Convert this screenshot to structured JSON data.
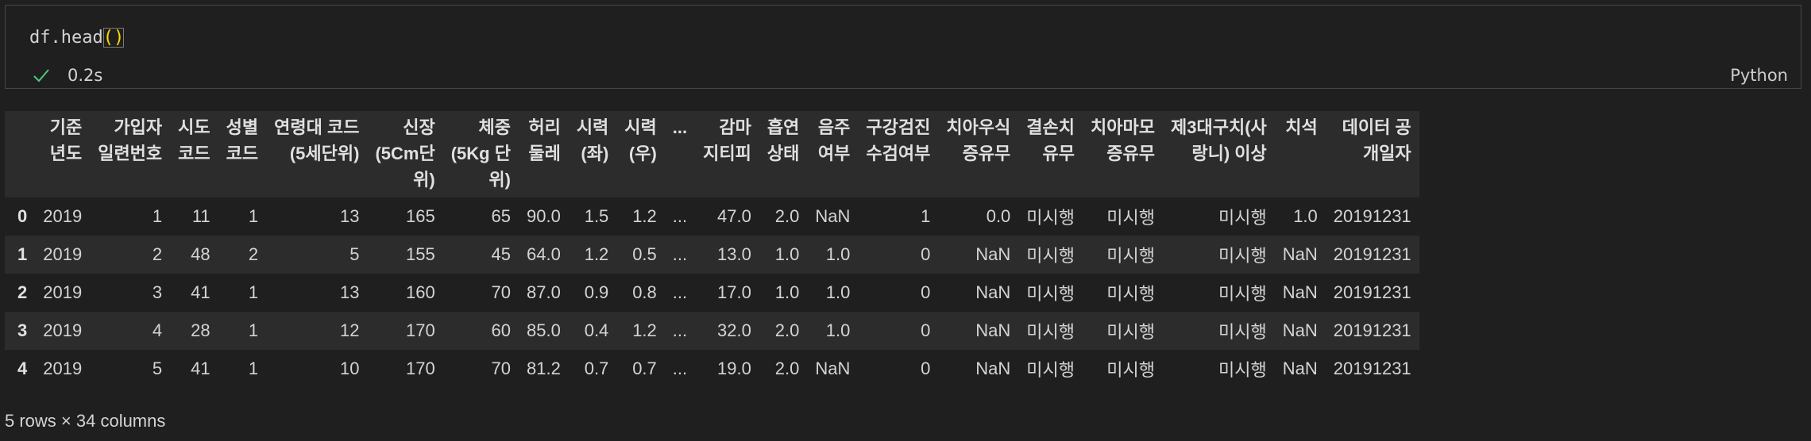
{
  "cell": {
    "code_prefix": "df.head",
    "code_parens": "()",
    "status_time": "0.2s",
    "language": "Python"
  },
  "table": {
    "columns": [
      "",
      "기준\n년도",
      "가입자\n일련번호",
      "시도\n코드",
      "성별\n코드",
      "연령대 코드\n(5세단위)",
      "신장\n(5Cm단\n위)",
      "체중\n(5Kg 단\n위)",
      "허리\n둘레",
      "시력\n(좌)",
      "시력\n(우)",
      "...",
      "감마\n지티피",
      "흡연\n상태",
      "음주\n여부",
      "구강검진\n수검여부",
      "치아우식\n증유무",
      "결손치\n유무",
      "치아마모\n증유무",
      "제3대구치(사\n랑니) 이상",
      "치석",
      "데이터 공\n개일자"
    ],
    "rows": [
      [
        "0",
        "2019",
        "1",
        "11",
        "1",
        "13",
        "165",
        "65",
        "90.0",
        "1.5",
        "1.2",
        "...",
        "47.0",
        "2.0",
        "NaN",
        "1",
        "0.0",
        "미시행",
        "미시행",
        "미시행",
        "1.0",
        "20191231"
      ],
      [
        "1",
        "2019",
        "2",
        "48",
        "2",
        "5",
        "155",
        "45",
        "64.0",
        "1.2",
        "0.5",
        "...",
        "13.0",
        "1.0",
        "1.0",
        "0",
        "NaN",
        "미시행",
        "미시행",
        "미시행",
        "NaN",
        "20191231"
      ],
      [
        "2",
        "2019",
        "3",
        "41",
        "1",
        "13",
        "160",
        "70",
        "87.0",
        "0.9",
        "0.8",
        "...",
        "17.0",
        "1.0",
        "1.0",
        "0",
        "NaN",
        "미시행",
        "미시행",
        "미시행",
        "NaN",
        "20191231"
      ],
      [
        "3",
        "2019",
        "4",
        "28",
        "1",
        "12",
        "170",
        "60",
        "85.0",
        "0.4",
        "1.2",
        "...",
        "32.0",
        "2.0",
        "1.0",
        "0",
        "NaN",
        "미시행",
        "미시행",
        "미시행",
        "NaN",
        "20191231"
      ],
      [
        "4",
        "2019",
        "5",
        "41",
        "1",
        "10",
        "170",
        "70",
        "81.2",
        "0.7",
        "0.7",
        "...",
        "19.0",
        "2.0",
        "NaN",
        "0",
        "NaN",
        "미시행",
        "미시행",
        "미시행",
        "NaN",
        "20191231"
      ]
    ],
    "summary": "5 rows × 34 columns"
  },
  "colors": {
    "background": "#1f1f1f",
    "row_alt": "#2c2c2c",
    "check": "#4ec97e",
    "paren": "#ffd700"
  },
  "icons": {
    "status": "checkmark-icon"
  }
}
